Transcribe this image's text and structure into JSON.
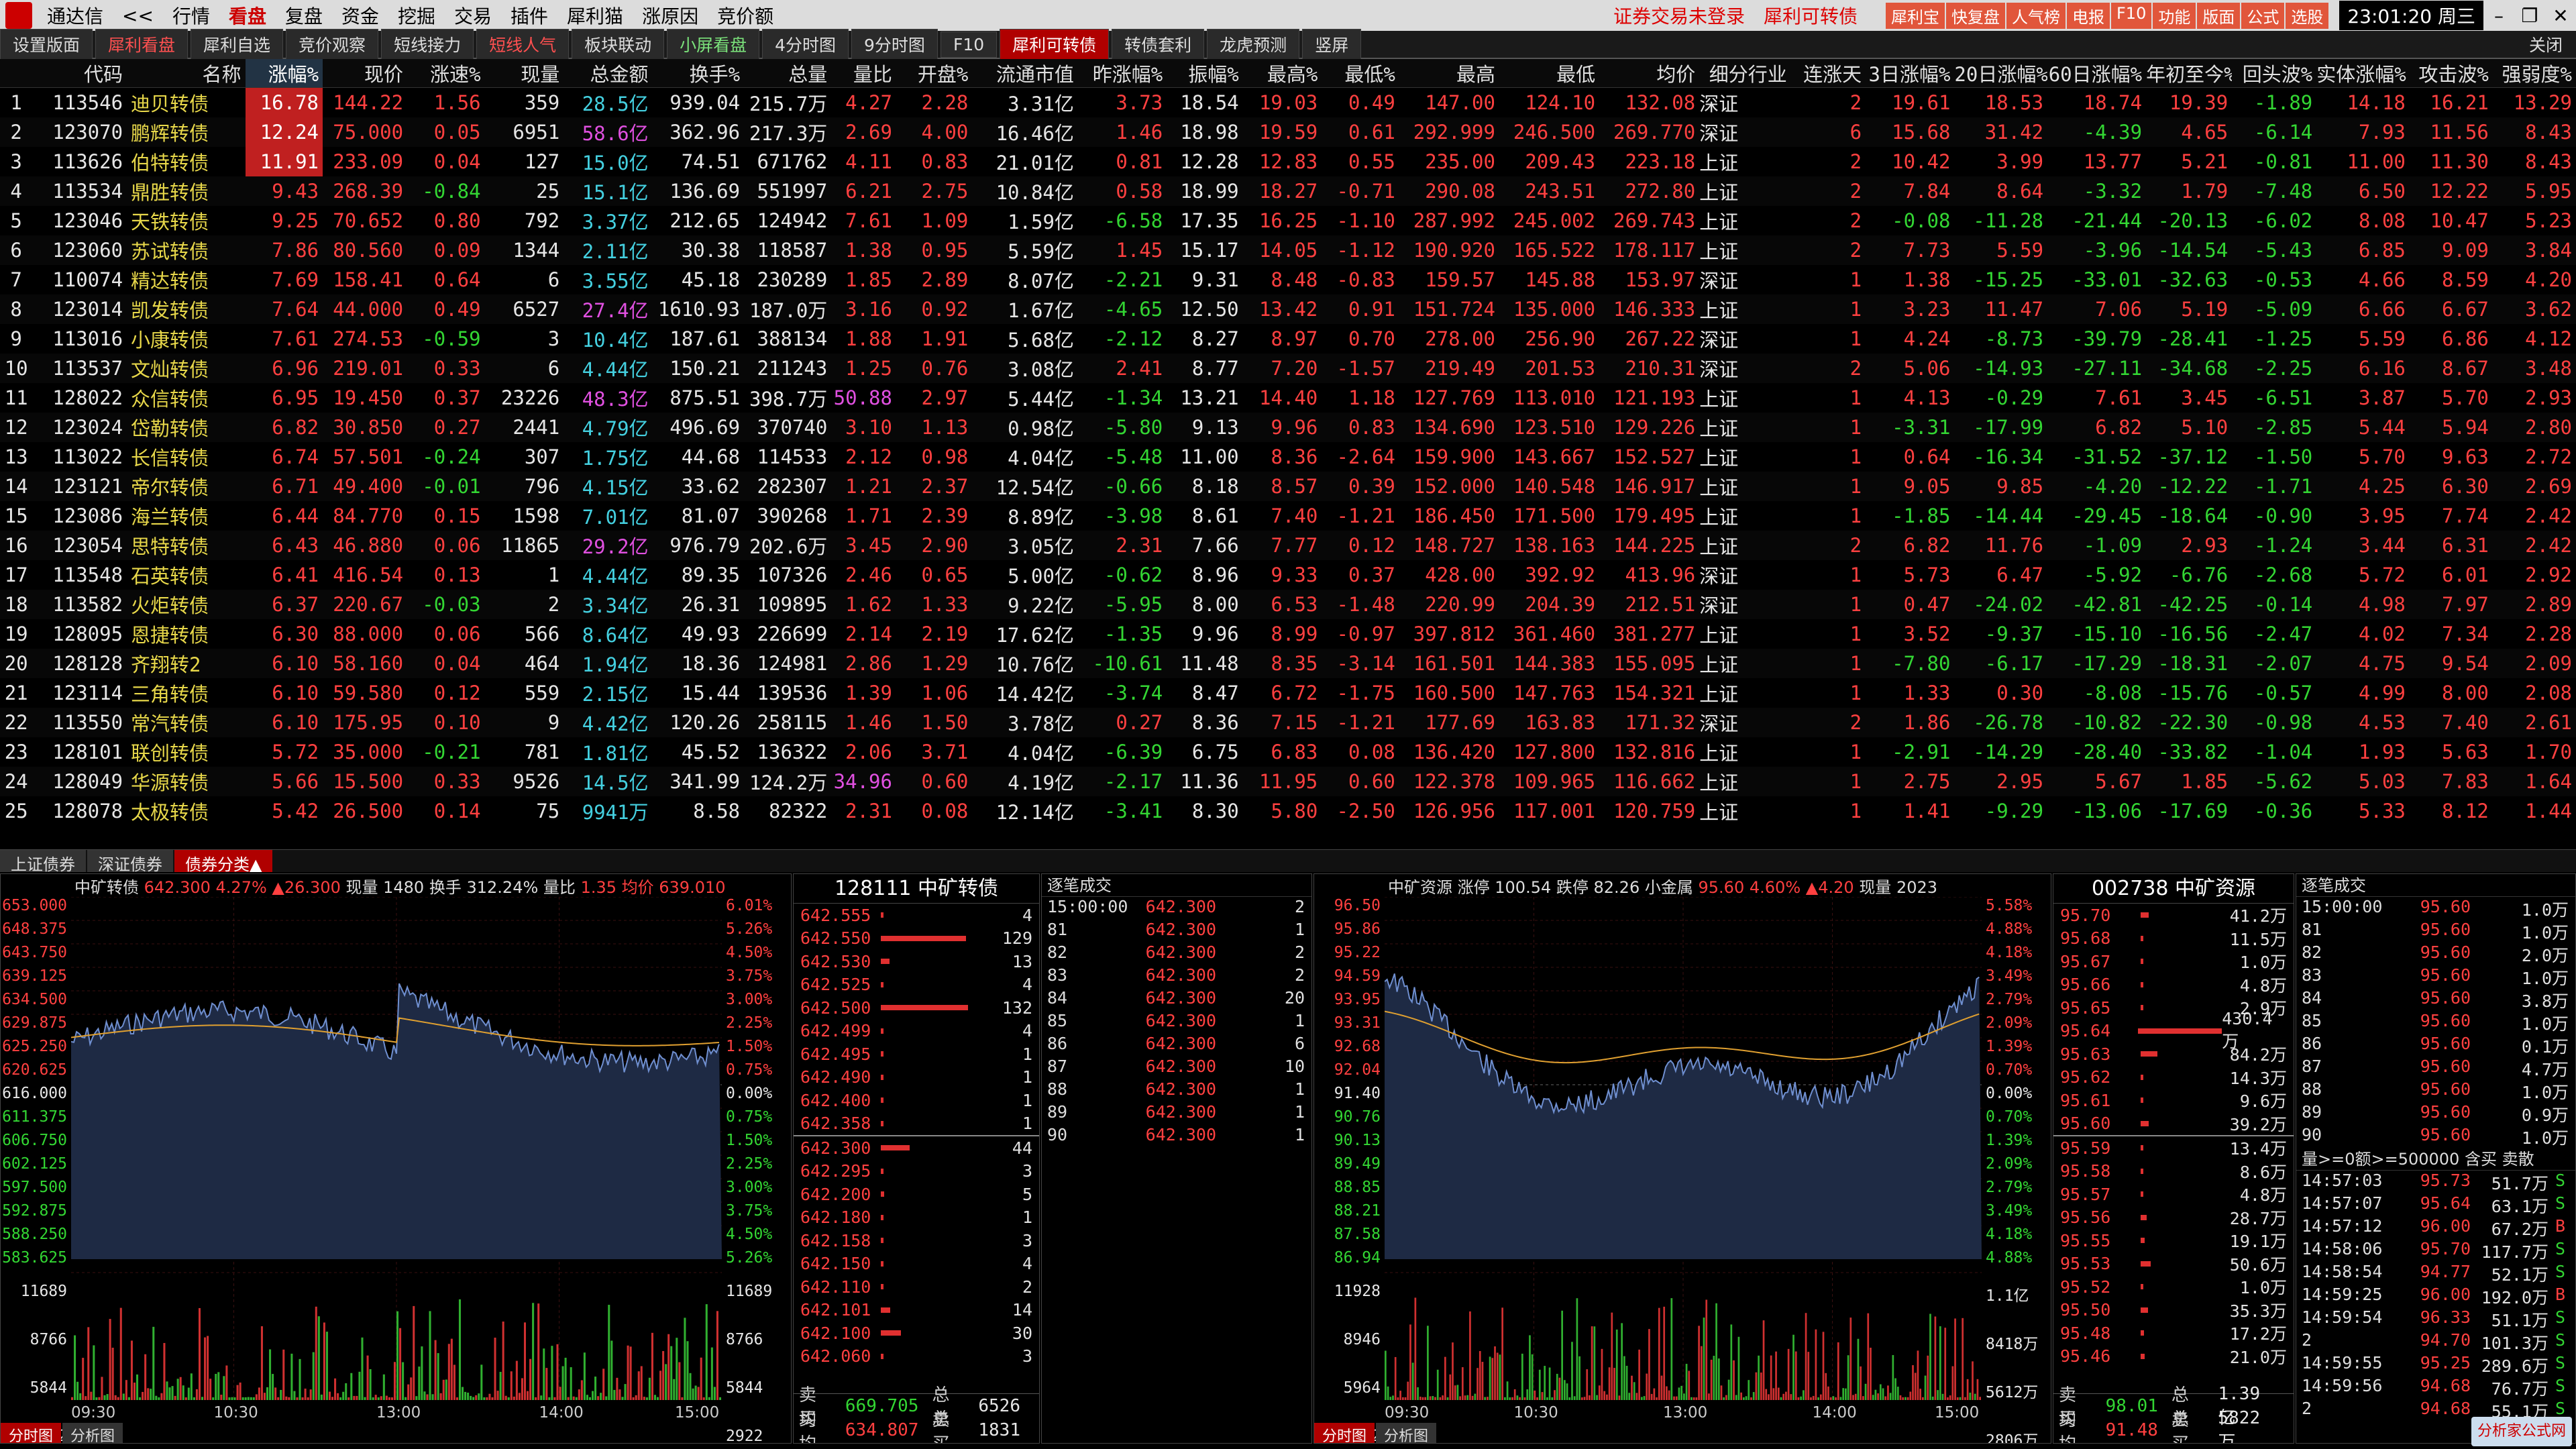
{
  "menu": {
    "app": "通达信",
    "back": "<<",
    "items": [
      "行情",
      "看盘",
      "复盘",
      "资金",
      "挖掘",
      "交易",
      "插件",
      "犀利猫",
      "涨原因",
      "竞价额"
    ],
    "notice1": "证券交易未登录",
    "notice2": "犀利可转债",
    "buttons": [
      "犀利宝",
      "快复盘",
      "人气榜",
      "电报",
      "F10",
      "功能",
      "版面",
      "公式",
      "选股"
    ],
    "clock": "23:01:20 周三"
  },
  "tabs": [
    "设置版面",
    "犀利看盘",
    "犀利自选",
    "竞价观察",
    "短线接力",
    "短线人气",
    "板块联动",
    "小屏看盘",
    "4分时图",
    "9分时图",
    "F10",
    "犀利可转债",
    "转债套利",
    "龙虎预测",
    "竖屏"
  ],
  "tabs_close": "关闭",
  "columns": [
    "",
    "代码",
    "名称",
    "涨幅%",
    "现价",
    "涨速%",
    "现量",
    "总金额",
    "换手%",
    "总量",
    "量比",
    "开盘%",
    "流通市值",
    "昨涨幅%",
    "振幅%",
    "最高%",
    "最低%",
    "最高",
    "最低",
    "均价",
    "细分行业",
    "连涨天",
    "3日涨幅%",
    "20日涨幅%",
    "60日涨幅%",
    "年初至今%",
    "回头波%",
    "实体涨幅%",
    "攻击波%",
    "强弱度%"
  ],
  "rows": [
    [
      "1",
      "113546",
      "迪贝转债",
      "16.78",
      "144.22",
      "1.56",
      "359",
      "28.5亿",
      "939.04",
      "215.7万",
      "4.27",
      "2.28",
      "3.31亿",
      "3.73",
      "18.54",
      "19.03",
      "0.49",
      "147.00",
      "124.10",
      "132.08",
      "深证",
      "2",
      "19.61",
      "18.53",
      "18.74",
      "19.39",
      "-1.89",
      "14.18",
      "16.21",
      "13.29"
    ],
    [
      "2",
      "123070",
      "鹏辉转债",
      "12.24",
      "75.000",
      "0.05",
      "6951",
      "58.6亿",
      "362.96",
      "217.3万",
      "2.69",
      "4.00",
      "16.46亿",
      "1.46",
      "18.98",
      "19.59",
      "0.61",
      "292.999",
      "246.500",
      "269.770",
      "深证",
      "6",
      "15.68",
      "31.42",
      "-4.39",
      "4.65",
      "-6.14",
      "7.93",
      "11.56",
      "8.43"
    ],
    [
      "3",
      "113626",
      "伯特转债",
      "11.91",
      "233.09",
      "0.04",
      "127",
      "15.0亿",
      "74.51",
      "671762",
      "4.11",
      "0.83",
      "21.01亿",
      "0.81",
      "12.28",
      "12.83",
      "0.55",
      "235.00",
      "209.43",
      "223.18",
      "上证",
      "2",
      "10.42",
      "3.99",
      "13.77",
      "5.21",
      "-0.81",
      "11.00",
      "11.30",
      "8.43"
    ],
    [
      "4",
      "113534",
      "鼎胜转债",
      "9.43",
      "268.39",
      "-0.84",
      "25",
      "15.1亿",
      "136.69",
      "551997",
      "6.21",
      "2.75",
      "10.84亿",
      "0.58",
      "18.99",
      "18.27",
      "-0.71",
      "290.08",
      "243.51",
      "272.80",
      "上证",
      "2",
      "7.84",
      "8.64",
      "-3.32",
      "1.79",
      "-7.48",
      "6.50",
      "12.22",
      "5.95"
    ],
    [
      "5",
      "123046",
      "天铁转债",
      "9.25",
      "70.652",
      "0.80",
      "792",
      "3.37亿",
      "212.65",
      "124942",
      "7.61",
      "1.09",
      "1.59亿",
      "-6.58",
      "17.35",
      "16.25",
      "-1.10",
      "287.992",
      "245.002",
      "269.743",
      "上证",
      "2",
      "-0.08",
      "-11.28",
      "-21.44",
      "-20.13",
      "-6.02",
      "8.08",
      "10.47",
      "5.23"
    ],
    [
      "6",
      "123060",
      "苏试转债",
      "7.86",
      "80.560",
      "0.09",
      "1344",
      "2.11亿",
      "30.38",
      "118587",
      "1.38",
      "0.95",
      "5.59亿",
      "1.45",
      "15.17",
      "14.05",
      "-1.12",
      "190.920",
      "165.522",
      "178.117",
      "上证",
      "2",
      "7.73",
      "5.59",
      "-3.96",
      "-14.54",
      "-5.43",
      "6.85",
      "9.09",
      "3.84"
    ],
    [
      "7",
      "110074",
      "精达转债",
      "7.69",
      "158.41",
      "0.64",
      "6",
      "3.55亿",
      "45.18",
      "230289",
      "1.85",
      "2.89",
      "8.07亿",
      "-2.21",
      "9.31",
      "8.48",
      "-0.83",
      "159.57",
      "145.88",
      "153.97",
      "深证",
      "1",
      "1.38",
      "-15.25",
      "-33.01",
      "-32.63",
      "-0.53",
      "4.66",
      "8.59",
      "4.20"
    ],
    [
      "8",
      "123014",
      "凯发转债",
      "7.64",
      "44.000",
      "0.49",
      "6527",
      "27.4亿",
      "1610.93",
      "187.0万",
      "3.16",
      "0.92",
      "1.67亿",
      "-4.65",
      "12.50",
      "13.42",
      "0.91",
      "151.724",
      "135.000",
      "146.333",
      "上证",
      "1",
      "3.23",
      "11.47",
      "7.06",
      "5.19",
      "-5.09",
      "6.66",
      "6.67",
      "3.62"
    ],
    [
      "9",
      "113016",
      "小康转债",
      "7.61",
      "274.53",
      "-0.59",
      "3",
      "10.4亿",
      "187.61",
      "388134",
      "1.88",
      "1.91",
      "5.68亿",
      "-2.12",
      "8.27",
      "8.97",
      "0.70",
      "278.00",
      "256.90",
      "267.22",
      "深证",
      "1",
      "4.24",
      "-8.73",
      "-39.79",
      "-28.41",
      "-1.25",
      "5.59",
      "6.86",
      "4.12"
    ],
    [
      "10",
      "113537",
      "文灿转债",
      "6.96",
      "219.01",
      "0.33",
      "6",
      "4.44亿",
      "150.21",
      "211243",
      "1.25",
      "0.76",
      "3.08亿",
      "2.41",
      "8.77",
      "7.20",
      "-1.57",
      "219.49",
      "201.53",
      "210.31",
      "深证",
      "2",
      "5.06",
      "-14.93",
      "-27.11",
      "-34.68",
      "-2.25",
      "6.16",
      "8.67",
      "3.48"
    ],
    [
      "11",
      "128022",
      "众信转债",
      "6.95",
      "19.450",
      "0.37",
      "23226",
      "48.3亿",
      "875.51",
      "398.7万",
      "50.88",
      "2.97",
      "5.44亿",
      "-1.34",
      "13.21",
      "14.40",
      "1.18",
      "127.769",
      "113.010",
      "121.193",
      "上证",
      "1",
      "4.13",
      "-0.29",
      "7.61",
      "3.45",
      "-6.51",
      "3.87",
      "5.70",
      "2.93"
    ],
    [
      "12",
      "123024",
      "岱勒转债",
      "6.82",
      "30.850",
      "0.27",
      "2441",
      "4.79亿",
      "496.69",
      "370740",
      "3.10",
      "1.13",
      "0.98亿",
      "-5.80",
      "9.13",
      "9.96",
      "0.83",
      "134.690",
      "123.510",
      "129.226",
      "上证",
      "1",
      "-3.31",
      "-17.99",
      "6.82",
      "5.10",
      "-2.85",
      "5.44",
      "5.94",
      "2.80"
    ],
    [
      "13",
      "113022",
      "长信转债",
      "6.74",
      "57.501",
      "-0.24",
      "307",
      "1.75亿",
      "44.68",
      "114533",
      "2.12",
      "0.98",
      "4.04亿",
      "-5.48",
      "11.00",
      "8.36",
      "-2.64",
      "159.900",
      "143.667",
      "152.527",
      "上证",
      "1",
      "0.64",
      "-16.34",
      "-31.52",
      "-37.12",
      "-1.50",
      "5.70",
      "9.63",
      "2.72"
    ],
    [
      "14",
      "123121",
      "帝尔转债",
      "6.71",
      "49.400",
      "-0.01",
      "796",
      "4.15亿",
      "33.62",
      "282307",
      "1.21",
      "2.37",
      "12.54亿",
      "-0.66",
      "8.18",
      "8.57",
      "0.39",
      "152.000",
      "140.548",
      "146.917",
      "上证",
      "1",
      "9.05",
      "9.85",
      "-4.20",
      "-12.22",
      "-1.71",
      "4.25",
      "6.30",
      "2.69"
    ],
    [
      "15",
      "123086",
      "海兰转债",
      "6.44",
      "84.770",
      "0.15",
      "1598",
      "7.01亿",
      "81.07",
      "390268",
      "1.71",
      "2.39",
      "8.89亿",
      "-3.98",
      "8.61",
      "7.40",
      "-1.21",
      "186.450",
      "171.500",
      "179.495",
      "上证",
      "1",
      "-1.85",
      "-14.44",
      "-29.45",
      "-18.64",
      "-0.90",
      "3.95",
      "7.74",
      "2.42"
    ],
    [
      "16",
      "123054",
      "思特转债",
      "6.43",
      "46.880",
      "0.06",
      "11865",
      "29.2亿",
      "976.79",
      "202.6万",
      "3.45",
      "2.90",
      "3.05亿",
      "2.31",
      "7.66",
      "7.77",
      "0.12",
      "148.727",
      "138.163",
      "144.225",
      "上证",
      "2",
      "6.82",
      "11.76",
      "-1.09",
      "2.93",
      "-1.24",
      "3.44",
      "6.31",
      "2.42"
    ],
    [
      "17",
      "113548",
      "石英转债",
      "6.41",
      "416.54",
      "0.13",
      "1",
      "4.44亿",
      "89.35",
      "107326",
      "2.46",
      "0.65",
      "5.00亿",
      "-0.62",
      "8.96",
      "9.33",
      "0.37",
      "428.00",
      "392.92",
      "413.96",
      "深证",
      "1",
      "5.73",
      "6.47",
      "-5.92",
      "-6.76",
      "-2.68",
      "5.72",
      "6.01",
      "2.92"
    ],
    [
      "18",
      "113582",
      "火炬转债",
      "6.37",
      "220.67",
      "-0.03",
      "2",
      "3.34亿",
      "26.31",
      "109895",
      "1.62",
      "1.33",
      "9.22亿",
      "-5.95",
      "8.00",
      "6.53",
      "-1.48",
      "220.99",
      "204.39",
      "212.51",
      "深证",
      "1",
      "0.47",
      "-24.02",
      "-42.81",
      "-42.25",
      "-0.14",
      "4.98",
      "7.97",
      "2.89"
    ],
    [
      "19",
      "128095",
      "恩捷转债",
      "6.30",
      "88.000",
      "0.06",
      "566",
      "8.64亿",
      "49.93",
      "226699",
      "2.14",
      "2.19",
      "17.62亿",
      "-1.35",
      "9.96",
      "8.99",
      "-0.97",
      "397.812",
      "361.460",
      "381.277",
      "上证",
      "1",
      "3.52",
      "-9.37",
      "-15.10",
      "-16.56",
      "-2.47",
      "4.02",
      "7.34",
      "2.28"
    ],
    [
      "20",
      "128128",
      "齐翔转2",
      "6.10",
      "58.160",
      "0.04",
      "464",
      "1.94亿",
      "18.36",
      "124981",
      "2.86",
      "1.29",
      "10.76亿",
      "-10.61",
      "11.48",
      "8.35",
      "-3.14",
      "161.501",
      "144.383",
      "155.095",
      "上证",
      "1",
      "-7.80",
      "-6.17",
      "-17.29",
      "-18.31",
      "-2.07",
      "4.75",
      "9.54",
      "2.09"
    ],
    [
      "21",
      "123114",
      "三角转债",
      "6.10",
      "59.580",
      "0.12",
      "559",
      "2.15亿",
      "15.44",
      "139536",
      "1.39",
      "1.06",
      "14.42亿",
      "-3.74",
      "8.47",
      "6.72",
      "-1.75",
      "160.500",
      "147.763",
      "154.321",
      "上证",
      "1",
      "1.33",
      "0.30",
      "-8.08",
      "-15.76",
      "-0.57",
      "4.99",
      "8.00",
      "2.08"
    ],
    [
      "22",
      "113550",
      "常汽转债",
      "6.10",
      "175.95",
      "0.10",
      "9",
      "4.42亿",
      "120.26",
      "258115",
      "1.46",
      "1.50",
      "3.78亿",
      "0.27",
      "8.36",
      "7.15",
      "-1.21",
      "177.69",
      "163.83",
      "171.32",
      "深证",
      "2",
      "1.86",
      "-26.78",
      "-10.82",
      "-22.30",
      "-0.98",
      "4.53",
      "7.40",
      "2.61"
    ],
    [
      "23",
      "128101",
      "联创转债",
      "5.72",
      "35.000",
      "-0.21",
      "781",
      "1.81亿",
      "45.52",
      "136322",
      "2.06",
      "3.71",
      "4.04亿",
      "-6.39",
      "6.75",
      "6.83",
      "0.08",
      "136.420",
      "127.800",
      "132.816",
      "上证",
      "1",
      "-2.91",
      "-14.29",
      "-28.40",
      "-33.82",
      "-1.04",
      "1.93",
      "5.63",
      "1.70"
    ],
    [
      "24",
      "128049",
      "华源转债",
      "5.66",
      "15.500",
      "0.33",
      "9526",
      "14.5亿",
      "341.99",
      "124.2万",
      "34.96",
      "0.60",
      "4.19亿",
      "-2.17",
      "11.36",
      "11.95",
      "0.60",
      "122.378",
      "109.965",
      "116.662",
      "上证",
      "1",
      "2.75",
      "2.95",
      "5.67",
      "1.85",
      "-5.62",
      "5.03",
      "7.83",
      "1.64"
    ],
    [
      "25",
      "128078",
      "太极转债",
      "5.42",
      "26.500",
      "0.14",
      "75",
      "9941万",
      "8.58",
      "82322",
      "2.31",
      "0.08",
      "12.14亿",
      "-3.41",
      "8.30",
      "5.80",
      "-2.50",
      "126.956",
      "117.001",
      "120.759",
      "上证",
      "1",
      "1.41",
      "-9.29",
      "-13.06",
      "-17.69",
      "-0.36",
      "5.33",
      "8.12",
      "1.44"
    ]
  ],
  "bottom_tabs": [
    "上证债券",
    "深证债券",
    "债券分类▲"
  ],
  "left_chart": {
    "info": {
      "name": "中矿转债",
      "price": "642.300",
      "pct": "4.27%",
      "chg": "▲26.300",
      "vol": "现量 1480",
      "turnover": "换手 312.24%",
      "ratio": "量比",
      "ratio_val": "1.35",
      "avg": "均价 639.010"
    },
    "left_axis": [
      "653.000",
      "648.375",
      "643.750",
      "639.125",
      "634.500",
      "629.875",
      "625.250",
      "620.625",
      "616.000",
      "611.375",
      "606.750",
      "602.125",
      "597.500",
      "592.875",
      "588.250",
      "583.625",
      "11689",
      "8766",
      "5844",
      "2922"
    ],
    "right_axis": [
      "6.01%",
      "5.26%",
      "4.50%",
      "3.75%",
      "3.00%",
      "2.25%",
      "1.50%",
      "0.75%",
      "0.00%",
      "0.75%",
      "1.50%",
      "2.25%",
      "3.00%",
      "3.75%",
      "4.50%",
      "5.26%",
      "11689",
      "8766",
      "5844",
      "2922"
    ],
    "times": [
      "09:30",
      "10:30",
      "13:00",
      "14:00",
      "15:00"
    ],
    "tabs": [
      "分时图",
      "分析图"
    ]
  },
  "orderbook1": {
    "title": "128111 中矿转债",
    "asks": [
      [
        "642.555",
        "4"
      ],
      [
        "642.550",
        "129"
      ],
      [
        "642.530",
        "13"
      ],
      [
        "642.525",
        "4"
      ],
      [
        "642.500",
        "132"
      ],
      [
        "642.499",
        "4"
      ],
      [
        "642.495",
        "1"
      ],
      [
        "642.490",
        "1"
      ],
      [
        "642.400",
        "1"
      ],
      [
        "642.358",
        "1"
      ]
    ],
    "bids": [
      [
        "642.300",
        "44"
      ],
      [
        "642.295",
        "3"
      ],
      [
        "642.200",
        "5"
      ],
      [
        "642.180",
        "1"
      ],
      [
        "642.158",
        "3"
      ],
      [
        "642.150",
        "4"
      ],
      [
        "642.110",
        "2"
      ],
      [
        "642.101",
        "14"
      ],
      [
        "642.100",
        "30"
      ],
      [
        "642.060",
        "3"
      ]
    ],
    "foot": {
      "l1": "卖均",
      "v1": "669.705",
      "l2": "总卖",
      "v2": "6526",
      "l3": "买均",
      "v3": "634.807",
      "l4": "总买",
      "v4": "1831"
    }
  },
  "trades1": {
    "title": "逐笔成交",
    "rows": [
      [
        "15:00:00",
        "642.300",
        "2"
      ],
      [
        "81",
        "642.300",
        "1"
      ],
      [
        "82",
        "642.300",
        "2"
      ],
      [
        "83",
        "642.300",
        "2"
      ],
      [
        "84",
        "642.300",
        "20"
      ],
      [
        "85",
        "642.300",
        "1"
      ],
      [
        "86",
        "642.300",
        "6"
      ],
      [
        "87",
        "642.300",
        "10"
      ],
      [
        "88",
        "642.300",
        "1"
      ],
      [
        "89",
        "642.300",
        "1"
      ],
      [
        "90",
        "642.300",
        "1"
      ]
    ]
  },
  "right_chart": {
    "info": {
      "name": "中矿资源",
      "limit_up": "涨停 100.54",
      "limit_down": "跌停 82.26",
      "sector": "小金属",
      "price": "95.60",
      "pct": "4.60%",
      "chg": "▲4.20",
      "vol": "现量 2023"
    },
    "left_axis": [
      "96.50",
      "95.86",
      "95.22",
      "94.59",
      "93.95",
      "93.31",
      "92.68",
      "92.04",
      "91.40",
      "90.76",
      "90.13",
      "89.49",
      "88.85",
      "88.21",
      "87.58",
      "86.94",
      "11928",
      "8946",
      "5964",
      "2982"
    ],
    "right_axis": [
      "5.58%",
      "4.88%",
      "4.18%",
      "3.49%",
      "2.79%",
      "2.09%",
      "1.39%",
      "0.70%",
      "0.00%",
      "0.70%",
      "1.39%",
      "2.09%",
      "2.79%",
      "3.49%",
      "4.18%",
      "4.88%",
      "1.1亿",
      "8418万",
      "5612万",
      "2806万"
    ],
    "times": [
      "09:30",
      "10:30",
      "13:00",
      "14:00",
      "15:00"
    ],
    "tabs": [
      "分时图",
      "分析图"
    ]
  },
  "orderbook2": {
    "title": "002738 中矿资源",
    "asks": [
      [
        "95.70",
        "41.2万"
      ],
      [
        "95.68",
        "11.5万"
      ],
      [
        "95.67",
        "1.0万"
      ],
      [
        "95.66",
        "4.8万"
      ],
      [
        "95.65",
        "2.9万"
      ],
      [
        "95.64",
        "430.4万"
      ],
      [
        "95.63",
        "84.2万"
      ],
      [
        "95.62",
        "14.3万"
      ],
      [
        "95.61",
        "9.6万"
      ],
      [
        "95.60",
        "39.2万"
      ]
    ],
    "bids": [
      [
        "95.59",
        "13.4万"
      ],
      [
        "95.58",
        "8.6万"
      ],
      [
        "95.57",
        "4.8万"
      ],
      [
        "95.56",
        "28.7万"
      ],
      [
        "95.55",
        "19.1万"
      ],
      [
        "95.53",
        "50.6万"
      ],
      [
        "95.52",
        "1.0万"
      ],
      [
        "95.50",
        "35.3万"
      ],
      [
        "95.48",
        "17.2万"
      ],
      [
        "95.46",
        "21.0万"
      ]
    ],
    "foot": {
      "l1": "卖均",
      "v1": "98.01",
      "l2": "总卖",
      "v2": "1.39亿",
      "l3": "买均",
      "v3": "91.48",
      "l4": "总买",
      "v4": "5822万"
    }
  },
  "trades2": {
    "title": "逐笔成交",
    "rows": [
      [
        "15:00:00",
        "95.60",
        "1.0万"
      ],
      [
        "81",
        "95.60",
        "1.0万"
      ],
      [
        "82",
        "95.60",
        "2.0万"
      ],
      [
        "83",
        "95.60",
        "1.0万"
      ],
      [
        "84",
        "95.60",
        "3.8万"
      ],
      [
        "85",
        "95.60",
        "1.0万"
      ],
      [
        "86",
        "95.60",
        "0.1万"
      ],
      [
        "87",
        "95.60",
        "4.7万"
      ],
      [
        "88",
        "95.60",
        "1.0万"
      ],
      [
        "89",
        "95.60",
        "0.9万"
      ],
      [
        "90",
        "95.60",
        "1.0万"
      ]
    ],
    "filter": "量>=0额>=500000 含买 卖散",
    "big": [
      [
        "14:57:03",
        "95.73",
        "51.7万",
        "S"
      ],
      [
        "14:57:07",
        "95.64",
        "63.1万",
        "S"
      ],
      [
        "14:57:12",
        "96.00",
        "67.2万",
        "B"
      ],
      [
        "14:58:06",
        "95.70",
        "117.7万",
        "S"
      ],
      [
        "14:58:54",
        "94.77",
        "52.1万",
        "S"
      ],
      [
        "14:59:25",
        "96.00",
        "192.0万",
        "B"
      ],
      [
        "14:59:54",
        "96.33",
        "51.1万",
        "S"
      ],
      [
        "2",
        "94.70",
        "101.3万",
        "S"
      ],
      [
        "14:59:55",
        "95.25",
        "289.6万",
        "S"
      ],
      [
        "14:59:56",
        "94.68",
        "76.7万",
        "S"
      ],
      [
        "2",
        "94.68",
        "55.1万",
        "S"
      ]
    ]
  },
  "watermark": "分析家公式网"
}
